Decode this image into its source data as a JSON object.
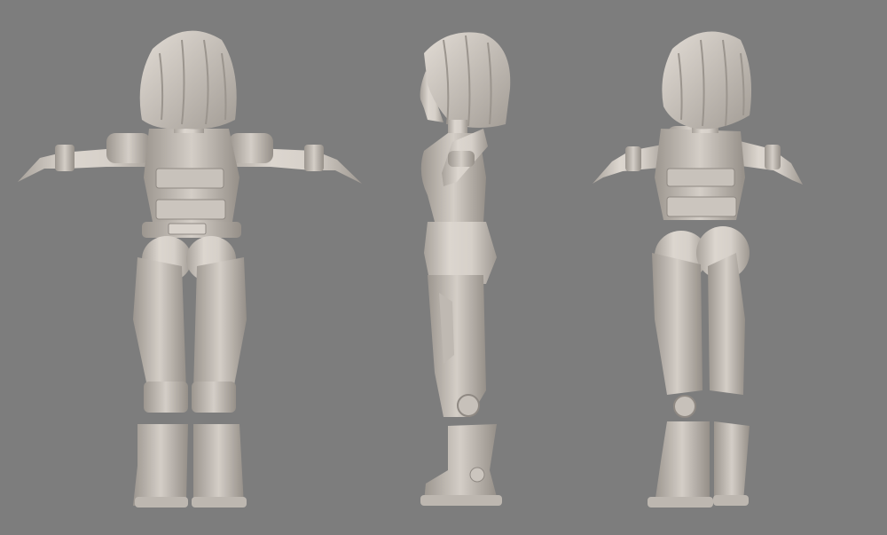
{
  "scene": {
    "background_color": "#7d7d7d",
    "model_color": "#d8d2cb",
    "model_shadow": "#a69f98",
    "model_dark": "#6f6a65",
    "views": [
      {
        "name": "back-view"
      },
      {
        "name": "side-view"
      },
      {
        "name": "three-quarter-back-view"
      }
    ]
  }
}
